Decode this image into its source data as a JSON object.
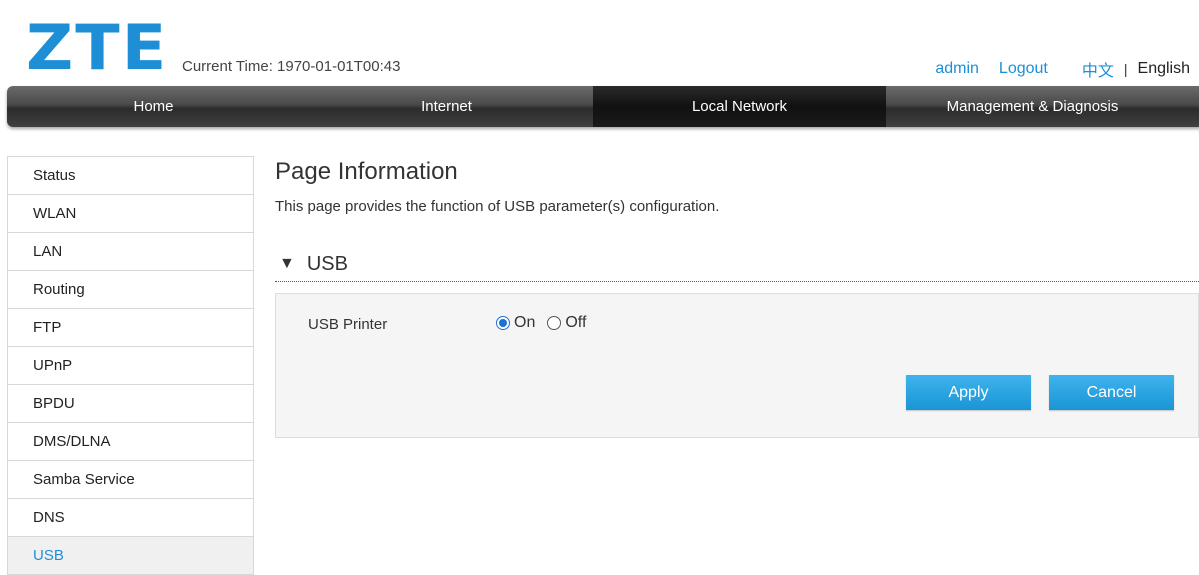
{
  "header": {
    "logo": "ZTE",
    "current_time_label": "Current Time:",
    "current_time_value": "1970-01-01T00:43",
    "user": "admin",
    "logout": "Logout",
    "lang_zh": "中文",
    "lang_sep": "|",
    "lang_en": "English"
  },
  "nav": {
    "tabs": [
      {
        "label": "Home",
        "active": false
      },
      {
        "label": "Internet",
        "active": false
      },
      {
        "label": "Local Network",
        "active": true
      },
      {
        "label": "Management & Diagnosis",
        "active": false
      }
    ]
  },
  "sidebar": {
    "items": [
      {
        "label": "Status"
      },
      {
        "label": "WLAN"
      },
      {
        "label": "LAN"
      },
      {
        "label": "Routing"
      },
      {
        "label": "FTP"
      },
      {
        "label": "UPnP"
      },
      {
        "label": "BPDU"
      },
      {
        "label": "DMS/DLNA"
      },
      {
        "label": "Samba Service"
      },
      {
        "label": "DNS"
      },
      {
        "label": "USB",
        "active": true
      }
    ]
  },
  "main": {
    "page_title": "Page Information",
    "page_desc": "This page provides the function of USB parameter(s) configuration.",
    "section_title": "USB",
    "usb_printer_label": "USB Printer",
    "usb_printer_value": "On",
    "options": [
      "On",
      "Off"
    ],
    "apply_label": "Apply",
    "cancel_label": "Cancel"
  },
  "colors": {
    "accent": "#1e8fd6",
    "button": "#28a4e2",
    "nav_active": "#1a1a1a"
  }
}
